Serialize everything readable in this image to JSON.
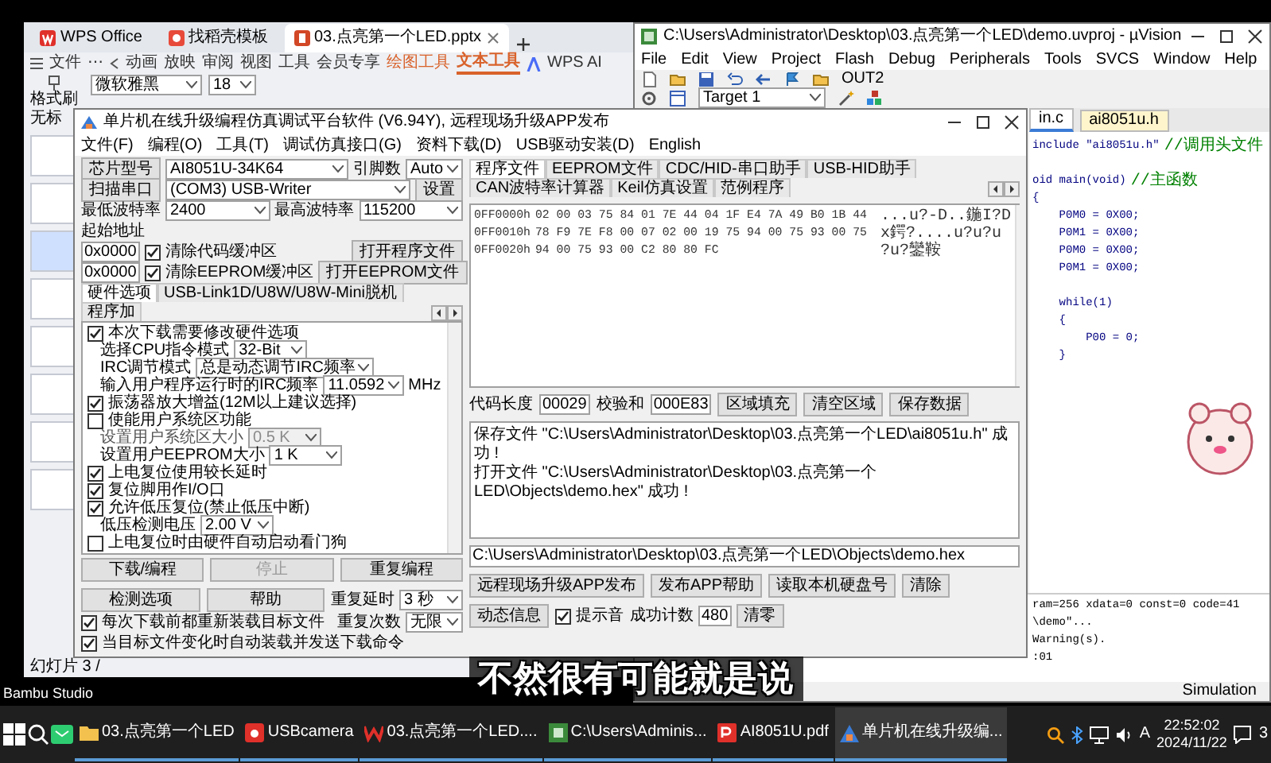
{
  "wps": {
    "tabs": [
      {
        "label": "WPS Office",
        "kind": "home",
        "selected": false
      },
      {
        "label": "找稻壳模板",
        "kind": "template",
        "selected": false
      },
      {
        "label": "03.点亮第一个LED.pptx",
        "kind": "pptx",
        "selected": true
      }
    ],
    "file_menu": "文件",
    "more": "⋯",
    "menu": [
      {
        "label": "动画",
        "kind": "plain",
        "selected": false
      },
      {
        "label": "放映",
        "kind": "plain",
        "selected": false
      },
      {
        "label": "审阅",
        "kind": "plain",
        "selected": false
      },
      {
        "label": "视图",
        "kind": "plain",
        "selected": false
      },
      {
        "label": "工具",
        "kind": "plain",
        "selected": false
      },
      {
        "label": "会员专享",
        "kind": "plain",
        "selected": false
      },
      {
        "label": "绘图工具",
        "kind": "context",
        "selected": false
      },
      {
        "label": "文本工具",
        "kind": "context",
        "selected": true
      }
    ],
    "ai": "WPS AI",
    "font_name": "微软雅黑",
    "font_size": "18",
    "format_painter": "格式刷",
    "side_label": "无标",
    "slide_counter": "幻灯片 3 /"
  },
  "desktop_icon": "Bambu Studio",
  "stc": {
    "title": "单片机在线升级编程仿真调试平台软件 (V6.94Y), 远程现场升级APP发布",
    "menu": [
      "文件(F)",
      "编程(O)",
      "工具(T)",
      "调试仿真接口(G)",
      "资料下载(D)",
      "USB驱动安装(D)",
      "English"
    ],
    "chip": {
      "button": "芯片型号",
      "value": "AI8051U-34K64",
      "pins_label": "引脚数",
      "pins": "Auto"
    },
    "port": {
      "button": "扫描串口",
      "value": "(COM3) USB-Writer",
      "settings": "设置"
    },
    "baud": {
      "min_label": "最低波特率",
      "min": "2400",
      "max_label": "最高波特率",
      "max": "115200"
    },
    "start_address_label": "起始地址",
    "buffers": [
      {
        "address": "0x0000",
        "label": "清除代码缓冲区",
        "checked": true,
        "button": "打开程序文件"
      },
      {
        "address": "0x0000",
        "label": "清除EEPROM缓冲区",
        "checked": true,
        "button": "打开EEPROM文件"
      }
    ],
    "left_tabs": [
      {
        "label": "硬件选项",
        "selected": true
      },
      {
        "label": "USB-Link1D/U8W/U8W-Mini脱机",
        "selected": false
      },
      {
        "label": "程序加",
        "selected": false
      }
    ],
    "options": [
      {
        "kind": "checkbox",
        "label": "本次下载需要修改硬件选项",
        "checked": true
      },
      {
        "kind": "select",
        "label": "选择CPU指令模式",
        "value": "32-Bit",
        "disabled": false
      },
      {
        "kind": "select",
        "label": "IRC调节模式",
        "value": "总是动态调节IRC频率",
        "disabled": false
      },
      {
        "kind": "select",
        "label": "输入用户程序运行时的IRC频率",
        "value": "11.0592",
        "unit": "MHz",
        "disabled": false
      },
      {
        "kind": "checkbox",
        "label": "振荡器放大增益(12M以上建议选择)",
        "checked": true
      },
      {
        "kind": "checkbox",
        "label": "使能用户系统区功能",
        "checked": false
      },
      {
        "kind": "select",
        "label": "设置用户系统区大小",
        "value": "0.5 K",
        "disabled": true
      },
      {
        "kind": "select",
        "label": "设置用户EEPROM大小",
        "value": "1 K",
        "disabled": false
      },
      {
        "kind": "checkbox",
        "label": "上电复位使用较长延时",
        "checked": true
      },
      {
        "kind": "checkbox",
        "label": "复位脚用作I/O口",
        "checked": true
      },
      {
        "kind": "checkbox",
        "label": "允许低压复位(禁止低压中断)",
        "checked": true
      },
      {
        "kind": "select",
        "label": "低压检测电压",
        "value": "2.00 V",
        "disabled": false
      },
      {
        "kind": "checkbox",
        "label": "上电复位时由硬件自动启动看门狗",
        "checked": false
      }
    ],
    "actions": [
      {
        "label": "下载/编程",
        "disabled": false
      },
      {
        "label": "停止",
        "disabled": true
      },
      {
        "label": "重复编程",
        "disabled": false
      },
      {
        "label": "检测选项",
        "disabled": false
      },
      {
        "label": "帮助",
        "disabled": false
      }
    ],
    "repeat_delay": {
      "label": "重复延时",
      "value": "3 秒"
    },
    "repeat_count": {
      "label": "重复次数",
      "value": "无限"
    },
    "reload_options": [
      {
        "label": "每次下载前都重新装载目标文件",
        "checked": true
      },
      {
        "label": "当目标文件变化时自动装载并发送下载命令",
        "checked": true
      }
    ],
    "right_tabs": [
      {
        "label": "程序文件",
        "selected": true
      },
      {
        "label": "EEPROM文件",
        "selected": false
      },
      {
        "label": "CDC/HID-串口助手",
        "selected": false
      },
      {
        "label": "USB-HID助手",
        "selected": false
      },
      {
        "label": "CAN波特率计算器",
        "selected": false
      },
      {
        "label": "Keil仿真设置",
        "selected": false
      },
      {
        "label": "范例程序",
        "selected": false
      }
    ],
    "hex_rows": [
      {
        "address": "0FF0000h",
        "bytes": "02 00 03 75 84 01 7E 44 04 1F E4 7A 49 B0 1B 44",
        "ascii": "...u?-D..鍦I?D"
      },
      {
        "address": "0FF0010h",
        "bytes": "78 F9 7E F8 00 07 02 00 19 75 94 00 75 93 00 75",
        "ascii": "x鍔?....u?u?u"
      },
      {
        "address": "0FF0020h",
        "bytes": "94 00 75 93 00 C2 80 80 FC",
        "ascii": "?u?鑾鞍"
      }
    ],
    "code_length": {
      "label": "代码长度",
      "value": "00029"
    },
    "checksum": {
      "label": "校验和",
      "value": "000E83"
    },
    "hex_buttons": [
      "区域填充",
      "清空区域",
      "保存数据"
    ],
    "log": [
      "保存文件 \"C:\\Users\\Administrator\\Desktop\\03.点亮第一个LED\\ai8051u.h\" 成功 !",
      "打开文件 \"C:\\Users\\Administrator\\Desktop\\03.点亮第一个LED\\Objects\\demo.hex\" 成功 !"
    ],
    "path": "C:\\Users\\Administrator\\Desktop\\03.点亮第一个LED\\Objects\\demo.hex",
    "bottom_buttons": [
      "远程现场升级APP发布",
      "发布APP帮助",
      "读取本机硬盘号",
      "清除",
      "动态信息"
    ],
    "beep": {
      "label": "提示音",
      "checked": true
    },
    "success_count": {
      "label": "成功计数",
      "value": "480"
    },
    "reset": "清零"
  },
  "keil": {
    "title": "C:\\Users\\Administrator\\Desktop\\03.点亮第一个LED\\demo.uvproj - µVision",
    "menu": [
      "File",
      "Edit",
      "View",
      "Project",
      "Flash",
      "Debug",
      "Peripherals",
      "Tools",
      "SVCS",
      "Window",
      "Help"
    ],
    "output_target": "OUT2",
    "target": "Target 1",
    "tabs": [
      {
        "label": "in.c",
        "selected": true
      },
      {
        "label": "ai8051u.h",
        "selected": false
      }
    ],
    "code": [
      {
        "kind": "code",
        "code": "include \"ai8051u.h\"",
        "comment": "//调用头文件"
      },
      {
        "kind": "blank"
      },
      {
        "kind": "code",
        "code": "oid main(void)",
        "comment": "//主函数"
      },
      {
        "kind": "code",
        "code": "{"
      },
      {
        "kind": "code",
        "code": "    P0M0 = 0X00;"
      },
      {
        "kind": "code",
        "code": "    P0M1 = 0X00;"
      },
      {
        "kind": "code",
        "code": "    P0M0 = 0X00;"
      },
      {
        "kind": "code",
        "code": "    P0M1 = 0X00;"
      },
      {
        "kind": "blank"
      },
      {
        "kind": "code",
        "code": "    while(1)"
      },
      {
        "kind": "code",
        "code": "    {"
      },
      {
        "kind": "code",
        "code": "        P00 = 0;"
      },
      {
        "kind": "code",
        "code": "    }"
      }
    ],
    "output": [
      "ram=256 xdata=0 const=0 code=41",
      "\\demo\"...",
      "Warning(s).",
      ":01"
    ],
    "status": "Simulation"
  },
  "subtitle": "不然很有可能就是说",
  "taskbar": {
    "apps": [
      {
        "label": "03.点亮第一个LED",
        "kind": "folder",
        "selected": false
      },
      {
        "label": "USBcamera",
        "kind": "camera",
        "selected": false
      },
      {
        "label": "03.点亮第一个LED....",
        "kind": "wps",
        "selected": false
      },
      {
        "label": "C:\\Users\\Adminis...",
        "kind": "keil",
        "selected": false
      },
      {
        "label": "AI8051U.pdf",
        "kind": "pdf",
        "selected": false
      },
      {
        "label": "单片机在线升级编...",
        "kind": "stc",
        "selected": true
      }
    ],
    "ime": "A",
    "time": "22:52:02",
    "date": "2024/11/22",
    "notifications": "3"
  }
}
